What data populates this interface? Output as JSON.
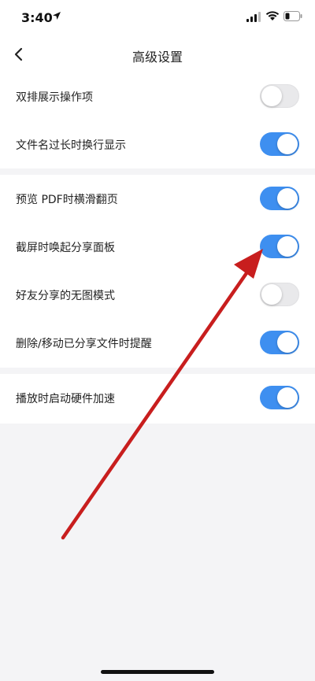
{
  "status_bar": {
    "time": "3:40",
    "icons": [
      "location-arrow-icon",
      "signal-icon",
      "wifi-icon",
      "battery-icon"
    ]
  },
  "nav": {
    "title": "高级设置",
    "back_icon": "chevron-left-icon"
  },
  "groups": [
    {
      "rows": [
        {
          "label": "双排展示操作项",
          "enabled": false
        },
        {
          "label": "文件名过长时换行显示",
          "enabled": true
        }
      ]
    },
    {
      "rows": [
        {
          "label": "预览 PDF时横滑翻页",
          "enabled": true
        },
        {
          "label": "截屏时唤起分享面板",
          "enabled": true
        },
        {
          "label": "好友分享的无图模式",
          "enabled": false
        },
        {
          "label": "删除/移动已分享文件时提醒",
          "enabled": true
        }
      ]
    },
    {
      "rows": [
        {
          "label": "播放时启动硬件加速",
          "enabled": true
        }
      ]
    }
  ],
  "colors": {
    "toggle_on": "#3e8ff0",
    "toggle_off": "#e9e9eb",
    "background": "#f4f4f6",
    "arrow": "#c81e1e"
  }
}
